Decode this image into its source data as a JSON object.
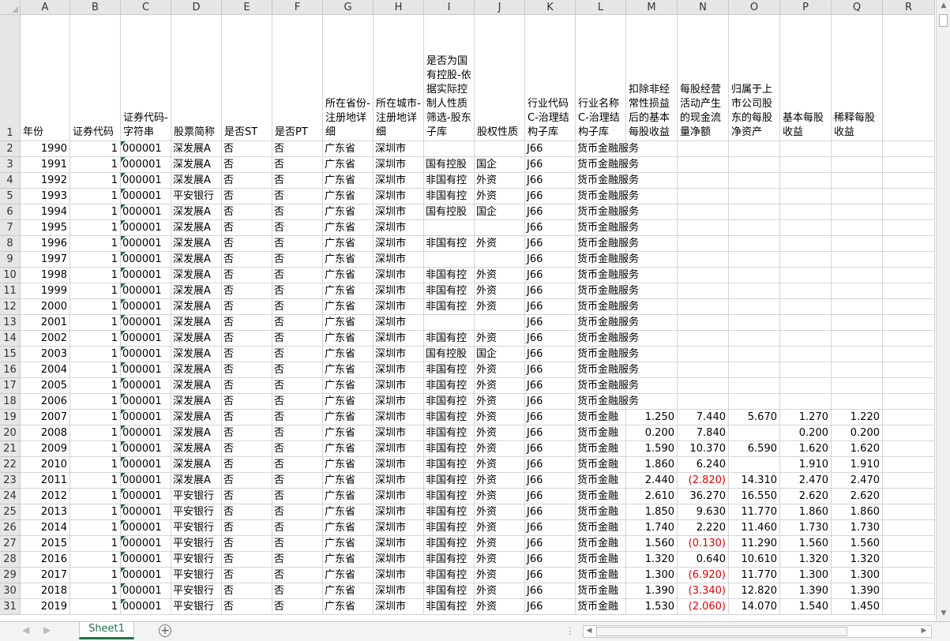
{
  "columns": [
    "A",
    "B",
    "C",
    "D",
    "E",
    "F",
    "G",
    "H",
    "I",
    "J",
    "K",
    "L",
    "M",
    "N",
    "O",
    "P",
    "Q",
    "R"
  ],
  "headers": {
    "A": "年份",
    "B": "证券代码",
    "C": "证券代码-字符串",
    "D": "股票简称",
    "E": "是否ST",
    "F": "是否PT",
    "G": "所在省份-注册地详细",
    "H": "所在城市-注册地详细",
    "I": "是否为国有控股-依据实际控制人性质筛选-股东子库",
    "J": "股权性质",
    "K": "行业代码C-治理结构子库",
    "L": "行业名称C-治理结构子库",
    "M": "扣除非经常性损益后的基本每股收益",
    "N": "每股经营活动产生的现金流量净额",
    "O": "归属于上市公司股东的每股净资产",
    "P": "基本每股收益",
    "Q": "稀释每股收益"
  },
  "rows": [
    {
      "A": "1990",
      "B": "1",
      "C": "000001",
      "D": "深发展A",
      "E": "否",
      "F": "否",
      "G": "广东省",
      "H": "深圳市",
      "I": "",
      "J": "",
      "K": "J66",
      "L": "货币金融服务",
      "M": "",
      "N": "",
      "O": "",
      "P": "",
      "Q": ""
    },
    {
      "A": "1991",
      "B": "1",
      "C": "000001",
      "D": "深发展A",
      "E": "否",
      "F": "否",
      "G": "广东省",
      "H": "深圳市",
      "I": "国有控股",
      "J": "国企",
      "K": "J66",
      "L": "货币金融服务",
      "M": "",
      "N": "",
      "O": "",
      "P": "",
      "Q": ""
    },
    {
      "A": "1992",
      "B": "1",
      "C": "000001",
      "D": "深发展A",
      "E": "否",
      "F": "否",
      "G": "广东省",
      "H": "深圳市",
      "I": "非国有控",
      "J": "外资",
      "K": "J66",
      "L": "货币金融服务",
      "M": "",
      "N": "",
      "O": "",
      "P": "",
      "Q": ""
    },
    {
      "A": "1993",
      "B": "1",
      "C": "000001",
      "D": "平安银行",
      "E": "否",
      "F": "否",
      "G": "广东省",
      "H": "深圳市",
      "I": "非国有控",
      "J": "外资",
      "K": "J66",
      "L": "货币金融服务",
      "M": "",
      "N": "",
      "O": "",
      "P": "",
      "Q": ""
    },
    {
      "A": "1994",
      "B": "1",
      "C": "000001",
      "D": "深发展A",
      "E": "否",
      "F": "否",
      "G": "广东省",
      "H": "深圳市",
      "I": "国有控股",
      "J": "国企",
      "K": "J66",
      "L": "货币金融服务",
      "M": "",
      "N": "",
      "O": "",
      "P": "",
      "Q": ""
    },
    {
      "A": "1995",
      "B": "1",
      "C": "000001",
      "D": "深发展A",
      "E": "否",
      "F": "否",
      "G": "广东省",
      "H": "深圳市",
      "I": "",
      "J": "",
      "K": "J66",
      "L": "货币金融服务",
      "M": "",
      "N": "",
      "O": "",
      "P": "",
      "Q": ""
    },
    {
      "A": "1996",
      "B": "1",
      "C": "000001",
      "D": "深发展A",
      "E": "否",
      "F": "否",
      "G": "广东省",
      "H": "深圳市",
      "I": "非国有控",
      "J": "外资",
      "K": "J66",
      "L": "货币金融服务",
      "M": "",
      "N": "",
      "O": "",
      "P": "",
      "Q": ""
    },
    {
      "A": "1997",
      "B": "1",
      "C": "000001",
      "D": "深发展A",
      "E": "否",
      "F": "否",
      "G": "广东省",
      "H": "深圳市",
      "I": "",
      "J": "",
      "K": "J66",
      "L": "货币金融服务",
      "M": "",
      "N": "",
      "O": "",
      "P": "",
      "Q": ""
    },
    {
      "A": "1998",
      "B": "1",
      "C": "000001",
      "D": "深发展A",
      "E": "否",
      "F": "否",
      "G": "广东省",
      "H": "深圳市",
      "I": "非国有控",
      "J": "外资",
      "K": "J66",
      "L": "货币金融服务",
      "M": "",
      "N": "",
      "O": "",
      "P": "",
      "Q": ""
    },
    {
      "A": "1999",
      "B": "1",
      "C": "000001",
      "D": "深发展A",
      "E": "否",
      "F": "否",
      "G": "广东省",
      "H": "深圳市",
      "I": "非国有控",
      "J": "外资",
      "K": "J66",
      "L": "货币金融服务",
      "M": "",
      "N": "",
      "O": "",
      "P": "",
      "Q": ""
    },
    {
      "A": "2000",
      "B": "1",
      "C": "000001",
      "D": "深发展A",
      "E": "否",
      "F": "否",
      "G": "广东省",
      "H": "深圳市",
      "I": "非国有控",
      "J": "外资",
      "K": "J66",
      "L": "货币金融服务",
      "M": "",
      "N": "",
      "O": "",
      "P": "",
      "Q": ""
    },
    {
      "A": "2001",
      "B": "1",
      "C": "000001",
      "D": "深发展A",
      "E": "否",
      "F": "否",
      "G": "广东省",
      "H": "深圳市",
      "I": "",
      "J": "",
      "K": "J66",
      "L": "货币金融服务",
      "M": "",
      "N": "",
      "O": "",
      "P": "",
      "Q": ""
    },
    {
      "A": "2002",
      "B": "1",
      "C": "000001",
      "D": "深发展A",
      "E": "否",
      "F": "否",
      "G": "广东省",
      "H": "深圳市",
      "I": "非国有控",
      "J": "外资",
      "K": "J66",
      "L": "货币金融服务",
      "M": "",
      "N": "",
      "O": "",
      "P": "",
      "Q": ""
    },
    {
      "A": "2003",
      "B": "1",
      "C": "000001",
      "D": "深发展A",
      "E": "否",
      "F": "否",
      "G": "广东省",
      "H": "深圳市",
      "I": "国有控股",
      "J": "国企",
      "K": "J66",
      "L": "货币金融服务",
      "M": "",
      "N": "",
      "O": "",
      "P": "",
      "Q": ""
    },
    {
      "A": "2004",
      "B": "1",
      "C": "000001",
      "D": "深发展A",
      "E": "否",
      "F": "否",
      "G": "广东省",
      "H": "深圳市",
      "I": "非国有控",
      "J": "外资",
      "K": "J66",
      "L": "货币金融服务",
      "M": "",
      "N": "",
      "O": "",
      "P": "",
      "Q": ""
    },
    {
      "A": "2005",
      "B": "1",
      "C": "000001",
      "D": "深发展A",
      "E": "否",
      "F": "否",
      "G": "广东省",
      "H": "深圳市",
      "I": "非国有控",
      "J": "外资",
      "K": "J66",
      "L": "货币金融服务",
      "M": "",
      "N": "",
      "O": "",
      "P": "",
      "Q": ""
    },
    {
      "A": "2006",
      "B": "1",
      "C": "000001",
      "D": "深发展A",
      "E": "否",
      "F": "否",
      "G": "广东省",
      "H": "深圳市",
      "I": "非国有控",
      "J": "外资",
      "K": "J66",
      "L": "货币金融服务",
      "M": "",
      "N": "",
      "O": "",
      "P": "",
      "Q": ""
    },
    {
      "A": "2007",
      "B": "1",
      "C": "000001",
      "D": "深发展A",
      "E": "否",
      "F": "否",
      "G": "广东省",
      "H": "深圳市",
      "I": "非国有控",
      "J": "外资",
      "K": "J66",
      "L": "货币金融",
      "M": "1.250",
      "N": "7.440",
      "O": "5.670",
      "P": "1.270",
      "Q": "1.220"
    },
    {
      "A": "2008",
      "B": "1",
      "C": "000001",
      "D": "深发展A",
      "E": "否",
      "F": "否",
      "G": "广东省",
      "H": "深圳市",
      "I": "非国有控",
      "J": "外资",
      "K": "J66",
      "L": "货币金融",
      "M": "0.200",
      "N": "7.840",
      "O": "",
      "P": "0.200",
      "Q": "0.200"
    },
    {
      "A": "2009",
      "B": "1",
      "C": "000001",
      "D": "深发展A",
      "E": "否",
      "F": "否",
      "G": "广东省",
      "H": "深圳市",
      "I": "非国有控",
      "J": "外资",
      "K": "J66",
      "L": "货币金融",
      "M": "1.590",
      "N": "10.370",
      "O": "6.590",
      "P": "1.620",
      "Q": "1.620"
    },
    {
      "A": "2010",
      "B": "1",
      "C": "000001",
      "D": "深发展A",
      "E": "否",
      "F": "否",
      "G": "广东省",
      "H": "深圳市",
      "I": "非国有控",
      "J": "外资",
      "K": "J66",
      "L": "货币金融",
      "M": "1.860",
      "N": "6.240",
      "O": "",
      "P": "1.910",
      "Q": "1.910"
    },
    {
      "A": "2011",
      "B": "1",
      "C": "000001",
      "D": "深发展A",
      "E": "否",
      "F": "否",
      "G": "广东省",
      "H": "深圳市",
      "I": "非国有控",
      "J": "外资",
      "K": "J66",
      "L": "货币金融",
      "M": "2.440",
      "N": "(2.820)",
      "O": "14.310",
      "P": "2.470",
      "Q": "2.470"
    },
    {
      "A": "2012",
      "B": "1",
      "C": "000001",
      "D": "平安银行",
      "E": "否",
      "F": "否",
      "G": "广东省",
      "H": "深圳市",
      "I": "非国有控",
      "J": "外资",
      "K": "J66",
      "L": "货币金融",
      "M": "2.610",
      "N": "36.270",
      "O": "16.550",
      "P": "2.620",
      "Q": "2.620"
    },
    {
      "A": "2013",
      "B": "1",
      "C": "000001",
      "D": "平安银行",
      "E": "否",
      "F": "否",
      "G": "广东省",
      "H": "深圳市",
      "I": "非国有控",
      "J": "外资",
      "K": "J66",
      "L": "货币金融",
      "M": "1.850",
      "N": "9.630",
      "O": "11.770",
      "P": "1.860",
      "Q": "1.860"
    },
    {
      "A": "2014",
      "B": "1",
      "C": "000001",
      "D": "平安银行",
      "E": "否",
      "F": "否",
      "G": "广东省",
      "H": "深圳市",
      "I": "非国有控",
      "J": "外资",
      "K": "J66",
      "L": "货币金融",
      "M": "1.740",
      "N": "2.220",
      "O": "11.460",
      "P": "1.730",
      "Q": "1.730"
    },
    {
      "A": "2015",
      "B": "1",
      "C": "000001",
      "D": "平安银行",
      "E": "否",
      "F": "否",
      "G": "广东省",
      "H": "深圳市",
      "I": "非国有控",
      "J": "外资",
      "K": "J66",
      "L": "货币金融",
      "M": "1.560",
      "N": "(0.130)",
      "O": "11.290",
      "P": "1.560",
      "Q": "1.560"
    },
    {
      "A": "2016",
      "B": "1",
      "C": "000001",
      "D": "平安银行",
      "E": "否",
      "F": "否",
      "G": "广东省",
      "H": "深圳市",
      "I": "非国有控",
      "J": "外资",
      "K": "J66",
      "L": "货币金融",
      "M": "1.320",
      "N": "0.640",
      "O": "10.610",
      "P": "1.320",
      "Q": "1.320"
    },
    {
      "A": "2017",
      "B": "1",
      "C": "000001",
      "D": "平安银行",
      "E": "否",
      "F": "否",
      "G": "广东省",
      "H": "深圳市",
      "I": "非国有控",
      "J": "外资",
      "K": "J66",
      "L": "货币金融",
      "M": "1.300",
      "N": "(6.920)",
      "O": "11.770",
      "P": "1.300",
      "Q": "1.300"
    },
    {
      "A": "2018",
      "B": "1",
      "C": "000001",
      "D": "平安银行",
      "E": "否",
      "F": "否",
      "G": "广东省",
      "H": "深圳市",
      "I": "非国有控",
      "J": "外资",
      "K": "J66",
      "L": "货币金融",
      "M": "1.390",
      "N": "(3.340)",
      "O": "12.820",
      "P": "1.390",
      "Q": "1.390"
    },
    {
      "A": "2019",
      "B": "1",
      "C": "000001",
      "D": "平安银行",
      "E": "否",
      "F": "否",
      "G": "广东省",
      "H": "深圳市",
      "I": "非国有控",
      "J": "外资",
      "K": "J66",
      "L": "货币金融",
      "M": "1.530",
      "N": "(2.060)",
      "O": "14.070",
      "P": "1.540",
      "Q": "1.450"
    }
  ],
  "sheet_tab": "Sheet1",
  "add_sheet_symbol": "+",
  "colors": {
    "negative": "#e00000",
    "accent": "#217346",
    "error_triangle": "#1e7145"
  }
}
